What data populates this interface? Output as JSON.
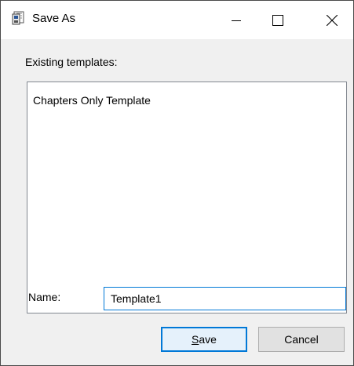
{
  "window": {
    "title": "Save As",
    "icon": "save-as-document-icon"
  },
  "caption_buttons": {
    "minimize_icon": "minimize-icon",
    "maximize_icon": "maximize-icon",
    "close_icon": "close-icon"
  },
  "existing_templates": {
    "label": "Existing templates:",
    "items": [
      {
        "label": "Chapters Only Template"
      }
    ]
  },
  "name_field": {
    "label": "Name:",
    "value": "Template1"
  },
  "buttons": {
    "save_mnemonic": "S",
    "save_rest": "ave",
    "cancel_label": "Cancel"
  },
  "colors": {
    "focus_accent": "#0078d7",
    "window_background": "#f0f0f0",
    "titlebar_background": "#ffffff"
  }
}
